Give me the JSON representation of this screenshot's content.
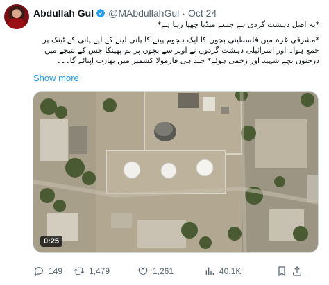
{
  "author": {
    "name": "Abdullah Gul",
    "handle": "@MAbdullahGul",
    "separator": "·",
    "date": "Oct 24"
  },
  "tweet": {
    "text_p1": "*یہ اصل دہشت گردی ہے جسے میڈیا چھپا رہا ہے*",
    "text_p2": "*مشرقی غزہ میں فلسطینی بچوں کا ایک ہجوم پینے کا پانی لینے کے لیے پانی کے ٹینک پر جمع ہوا۔ اور اسرائیلی دہشت گردوں نے اوپر سے بچوں پر بم پھینکا جس کے نتیجے میں درجنوں بچے شہید اور زخمی ہوئے* جلد ہی فارمولا کشمیر میں بھارت اپنائے گا۔۔۔",
    "show_more": "Show more"
  },
  "media": {
    "duration": "0:25",
    "type": "video"
  },
  "actions": {
    "replies": "149",
    "retweets": "1,479",
    "likes": "1,261",
    "views": "40.1K"
  },
  "colors": {
    "accent": "#1d9bf0",
    "secondary_text": "#536471",
    "verified_badge": "#1d9bf0"
  },
  "icons": [
    "verified-badge-icon",
    "reply-icon",
    "retweet-icon",
    "like-icon",
    "views-icon",
    "bookmark-icon",
    "share-icon"
  ]
}
